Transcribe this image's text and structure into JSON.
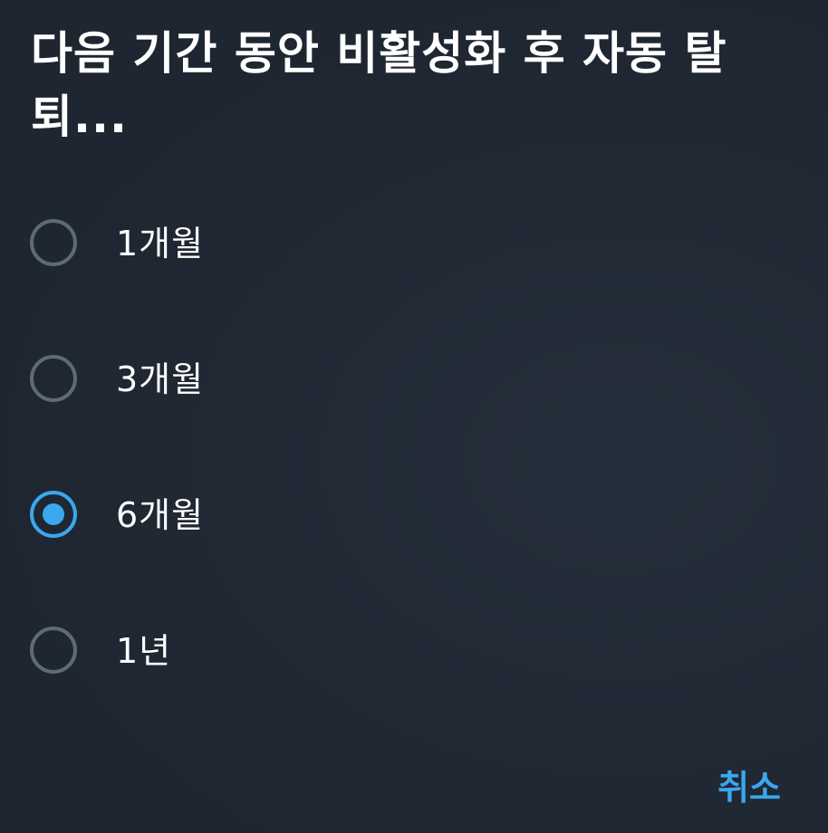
{
  "dialog": {
    "title": "다음 기간 동안 비활성화 후 자동 탈퇴...",
    "options": [
      {
        "label": "1개월",
        "selected": false
      },
      {
        "label": "3개월",
        "selected": false
      },
      {
        "label": "6개월",
        "selected": true
      },
      {
        "label": "1년",
        "selected": false
      }
    ],
    "cancel_label": "취소"
  },
  "colors": {
    "background": "#1f2732",
    "accent": "#3aa7ee",
    "radio_unselected": "#5f6a77",
    "text": "#ffffff"
  }
}
